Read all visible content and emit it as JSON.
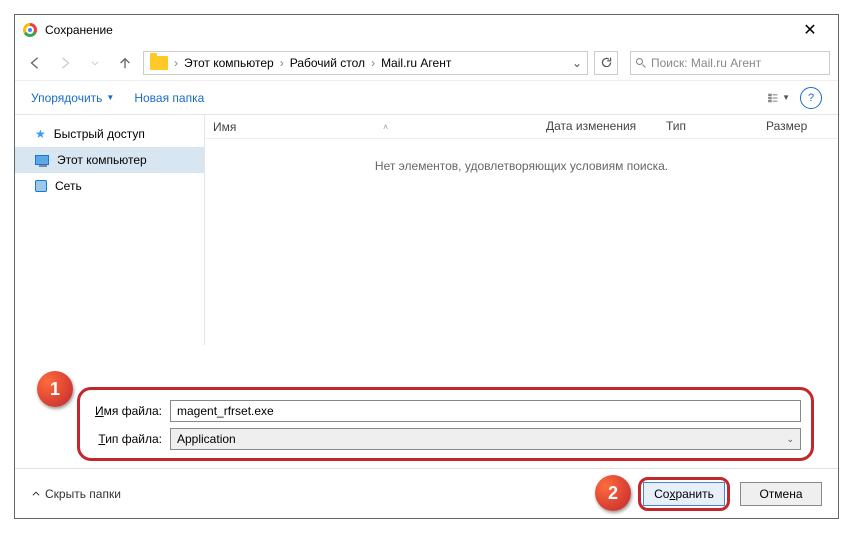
{
  "titlebar": {
    "title": "Сохранение"
  },
  "breadcrumb": {
    "items": [
      "Этот компьютер",
      "Рабочий стол",
      "Mail.ru Агент"
    ]
  },
  "search": {
    "placeholder": "Поиск: Mail.ru Агент"
  },
  "toolbar": {
    "organize": "Упорядочить",
    "newfolder": "Новая папка"
  },
  "sidebar": {
    "items": [
      {
        "label": "Быстрый доступ"
      },
      {
        "label": "Этот компьютер"
      },
      {
        "label": "Сеть"
      }
    ]
  },
  "columns": {
    "name": "Имя",
    "date": "Дата изменения",
    "type": "Тип",
    "size": "Размер"
  },
  "empty_message": "Нет элементов, удовлетворяющих условиям поиска.",
  "fields": {
    "filename_label_pre": "И",
    "filename_label_post": "мя файла:",
    "filetype_label_pre": "Т",
    "filetype_label_post": "ип файла:",
    "filename_value": "magent_rfrset.exe",
    "filetype_value": "Application"
  },
  "footer": {
    "hide": "Скрыть папки",
    "save_pre": "Со",
    "save_u": "х",
    "save_post": "ранить",
    "cancel": "Отмена"
  },
  "callouts": {
    "one": "1",
    "two": "2"
  }
}
